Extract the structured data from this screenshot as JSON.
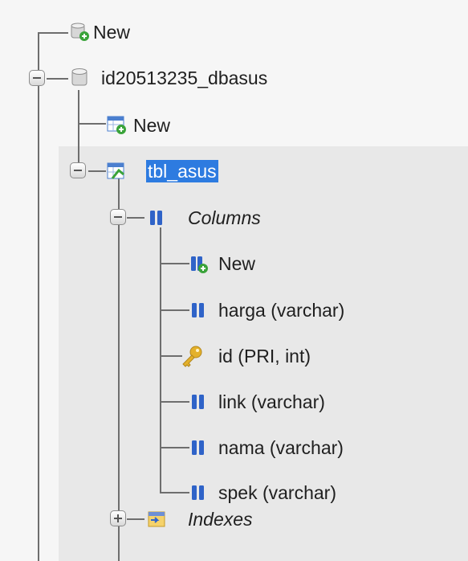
{
  "tree": {
    "new_db": {
      "label": "New",
      "icon": "db-new-icon"
    },
    "database": {
      "label": "id20513235_dbasus",
      "icon": "database-icon"
    },
    "new_table": {
      "label": "New",
      "icon": "table-new-icon"
    },
    "table": {
      "label": "tbl_asus",
      "icon": "table-icon",
      "selected": true
    },
    "columns_group": {
      "label": "Columns",
      "icon": "columns-icon"
    },
    "columns": [
      {
        "label": "New",
        "icon": "column-new-icon"
      },
      {
        "label": "harga (varchar)",
        "icon": "column-icon"
      },
      {
        "label": "id (PRI, int)",
        "icon": "primary-key-icon"
      },
      {
        "label": "link (varchar)",
        "icon": "column-icon"
      },
      {
        "label": "nama (varchar)",
        "icon": "column-icon"
      },
      {
        "label": "spek (varchar)",
        "icon": "column-icon"
      }
    ],
    "indexes_group": {
      "label": "Indexes",
      "icon": "indexes-icon"
    }
  },
  "colors": {
    "selection": "#2d7be0",
    "panel_bg": "#f6f6f6",
    "highlight_bg": "#e8e8e8",
    "column_icon": "#2f63c8",
    "key_icon": "#e4b12b",
    "add_badge": "#3aa33a"
  }
}
